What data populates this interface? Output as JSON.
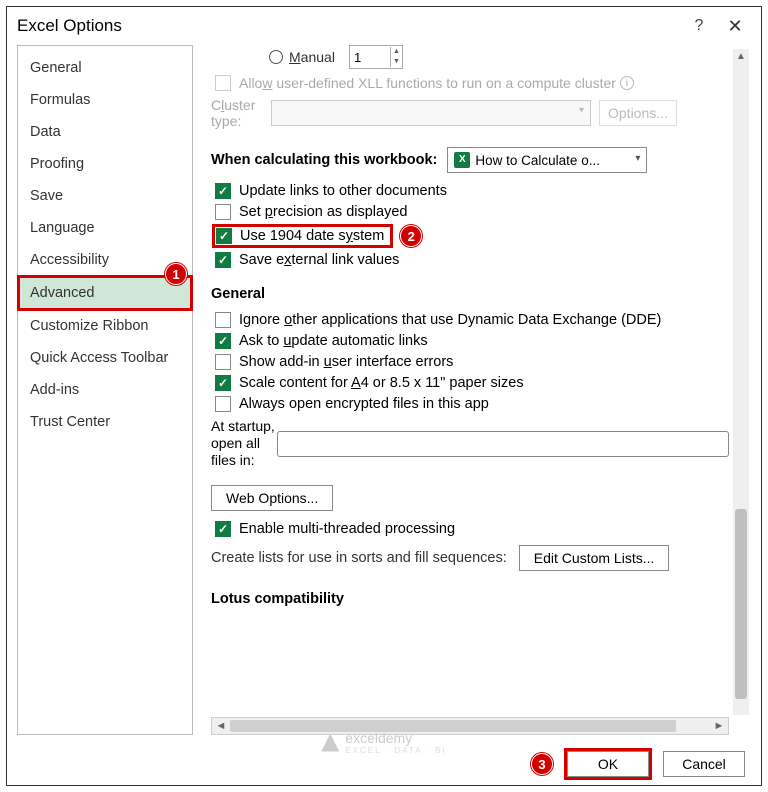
{
  "dialog": {
    "title": "Excel Options"
  },
  "sidebar": {
    "items": [
      "General",
      "Formulas",
      "Data",
      "Proofing",
      "Save",
      "Language",
      "Accessibility",
      "Advanced",
      "Customize Ribbon",
      "Quick Access Toolbar",
      "Add-ins",
      "Trust Center"
    ],
    "selected_index": 7
  },
  "formulas_section": {
    "manual_label": "Manual",
    "manual_value": "1",
    "xll_label": "Allow user-defined XLL functions to run on a compute cluster",
    "cluster_label": "Cluster type:",
    "options_btn": "Options..."
  },
  "workbook_section": {
    "heading": "When calculating this workbook:",
    "dropdown_value": "How to Calculate o...",
    "opts": {
      "update_links": {
        "label_pre": "",
        "label": "Update links to other documents",
        "checked": true
      },
      "precision": {
        "label": "Set precision as displayed",
        "checked": false,
        "u": "p"
      },
      "date1904": {
        "label": "Use 1904 date system",
        "checked": true,
        "u": "y"
      },
      "external": {
        "label": "Save external link values",
        "checked": true,
        "u": "x"
      }
    }
  },
  "general_section": {
    "heading": "General",
    "opts": {
      "dde": {
        "label": "Ignore other applications that use Dynamic Data Exchange (DDE)",
        "checked": false
      },
      "autolinks": {
        "label": "Ask to update automatic links",
        "checked": true
      },
      "addin_err": {
        "label": "Show add-in user interface errors",
        "checked": false
      },
      "scale": {
        "label": "Scale content for A4 or 8.5 x 11\" paper sizes",
        "checked": true
      },
      "encrypted": {
        "label": "Always open encrypted files in this app",
        "checked": false
      }
    },
    "startup_label": "At startup, open all files in:",
    "web_options_btn": "Web Options...",
    "multithread": {
      "label": "Enable multi-threaded processing",
      "checked": true
    },
    "lists_label": "Create lists for use in sorts and fill sequences:",
    "edit_lists_btn": "Edit Custom Lists..."
  },
  "lotus_section": {
    "heading": "Lotus compatibility"
  },
  "footer": {
    "ok": "OK",
    "cancel": "Cancel"
  },
  "callouts": {
    "c1": "1",
    "c2": "2",
    "c3": "3"
  },
  "watermark": {
    "name": "exceldemy",
    "tag": "EXCEL · DATA · BI"
  }
}
